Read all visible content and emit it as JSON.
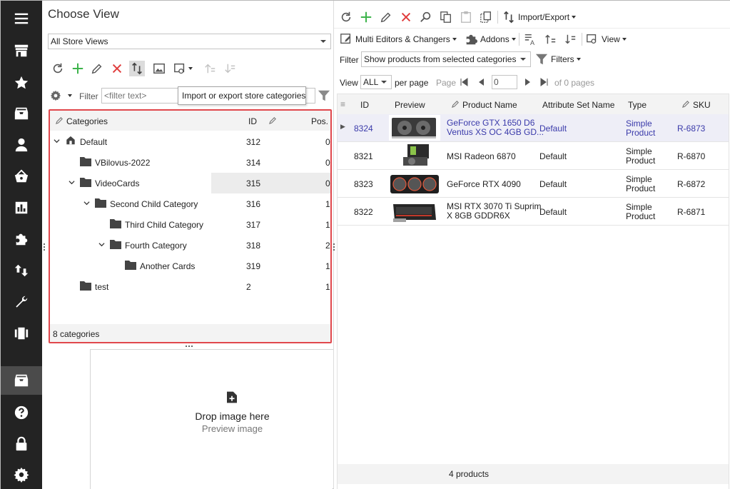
{
  "colors": {
    "sidebar_bg": "#232323",
    "highlight_border": "#e0474c",
    "link_blue": "#3a3aaa",
    "add_green": "#3cb34a",
    "delete_red": "#e03c3c"
  },
  "sidebar": {
    "icons": [
      "menu-icon",
      "store-icon",
      "star-icon",
      "inbox-icon",
      "user-icon",
      "basket-icon",
      "chart-icon",
      "puzzle-icon",
      "transfer-icon",
      "wrench-icon",
      "columns-icon",
      "inbox-active-icon",
      "help-icon",
      "lock-icon",
      "gear-icon"
    ]
  },
  "left": {
    "title": "Choose View",
    "store_select": "All Store Views",
    "filter_label": "Filter",
    "filter_placeholder": "<filter text>",
    "tooltip": "Import or export store categories",
    "grid": {
      "columns": {
        "name": "Categories",
        "id": "ID",
        "pos": "Pos."
      },
      "rows": [
        {
          "name": "Default",
          "id": "312",
          "pos": "0"
        },
        {
          "name": "VBilovus-2022",
          "id": "314",
          "pos": "0"
        },
        {
          "name": "VideoCards",
          "id": "315",
          "pos": "0"
        },
        {
          "name": "Second Child Category",
          "id": "316",
          "pos": "1"
        },
        {
          "name": "Third Child Category",
          "id": "317",
          "pos": "1"
        },
        {
          "name": "Fourth Category",
          "id": "318",
          "pos": "2"
        },
        {
          "name": "Another Cards",
          "id": "319",
          "pos": "1"
        },
        {
          "name": "test",
          "id": "2",
          "pos": "1"
        }
      ],
      "footer": "8 categories"
    },
    "drop": {
      "title": "Drop image here",
      "subtitle": "Preview image"
    }
  },
  "right": {
    "toolbar1": {
      "import_export": "Import/Export"
    },
    "toolbar2": {
      "multi_editors": "Multi Editors & Changers",
      "addons": "Addons",
      "view": "View"
    },
    "filter": {
      "label": "Filter",
      "value": "Show products from selected categories",
      "filters_btn": "Filters"
    },
    "paging": {
      "view_label": "View",
      "view_value": "ALL",
      "per_page": "per page",
      "page_label": "Page",
      "page_value": "0",
      "of_pages": "of 0 pages"
    },
    "table": {
      "columns": {
        "id": "ID",
        "preview": "Preview",
        "name": "Product Name",
        "attr": "Attribute Set Name",
        "type": "Type",
        "sku": "SKU"
      },
      "rows": [
        {
          "id": "8324",
          "name1": "GeForce GTX 1650 D6",
          "name2": "Ventus XS OC 4GB GD...",
          "attr": "Default",
          "type1": "Simple",
          "type2": "Product",
          "sku": "R-6873"
        },
        {
          "id": "8321",
          "name1": "MSI Radeon 6870",
          "name2": "",
          "attr": "Default",
          "type1": "Simple",
          "type2": "Product",
          "sku": "R-6870"
        },
        {
          "id": "8323",
          "name1": "GeForce RTX 4090",
          "name2": "",
          "attr": "Default",
          "type1": "Simple",
          "type2": "Product",
          "sku": "R-6872"
        },
        {
          "id": "8322",
          "name1": "MSI RTX 3070 Ti Suprim",
          "name2": "X 8GB GDDR6X",
          "attr": "Default",
          "type1": "Simple",
          "type2": "Product",
          "sku": "R-6871"
        }
      ],
      "footer": "4 products"
    }
  }
}
